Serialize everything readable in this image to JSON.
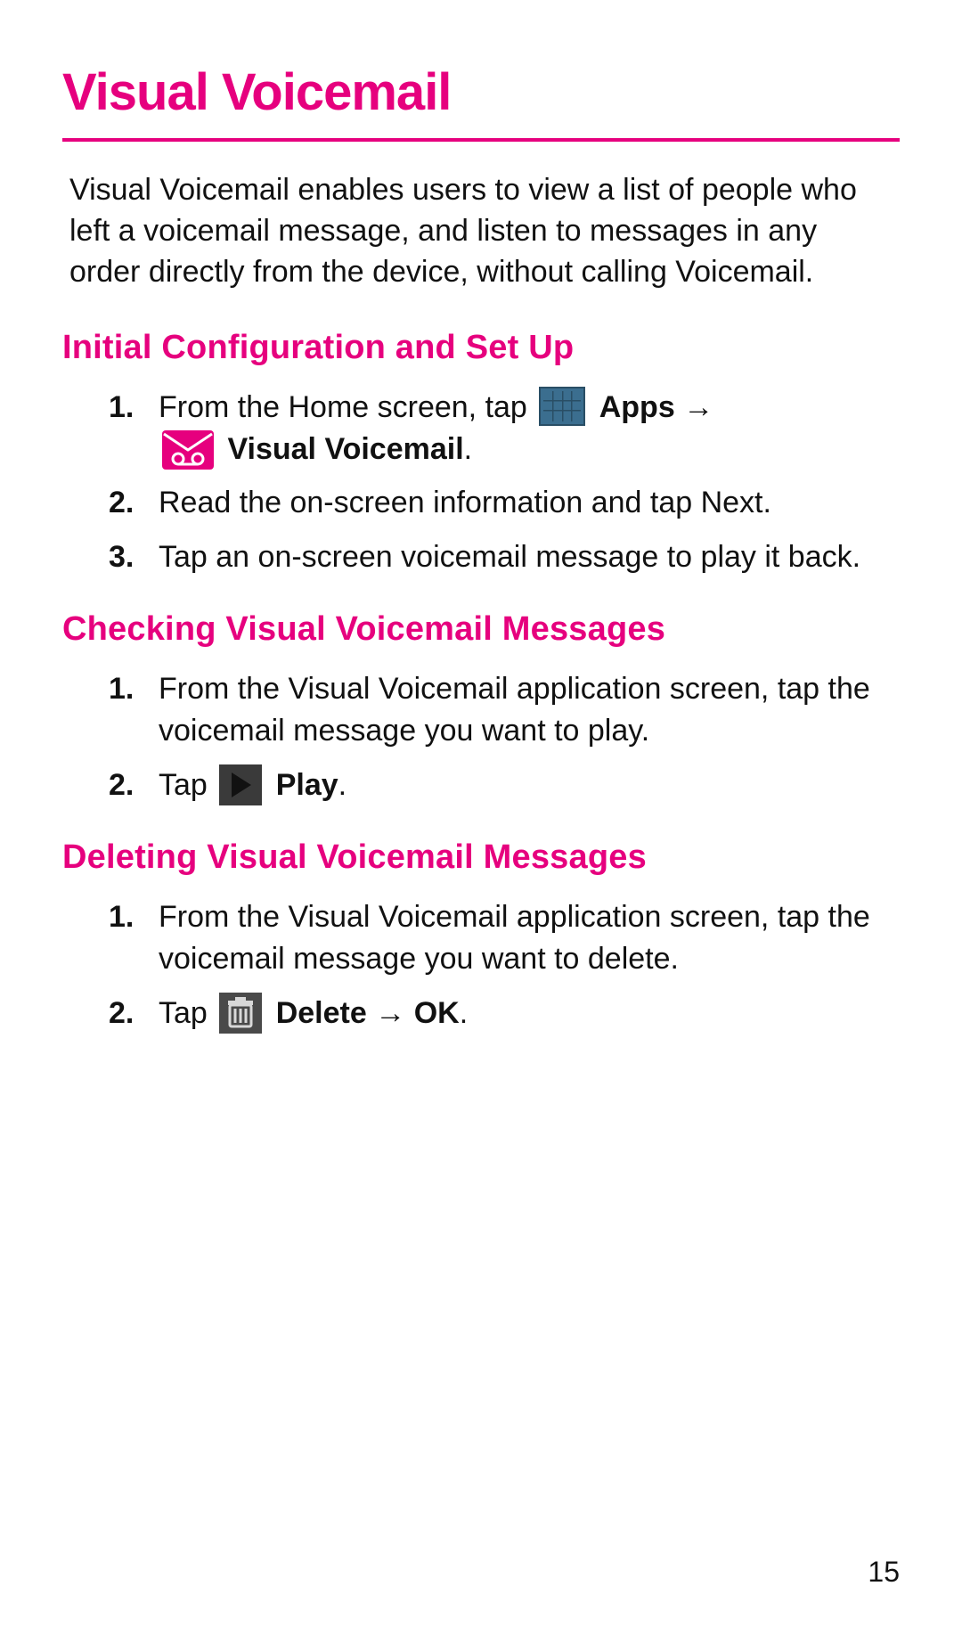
{
  "title": "Visual Voicemail",
  "intro": "Visual Voicemail enables users to view a list of people who left a voicemail message, and listen to messages in any order directly from the device, without calling Voicemail.",
  "section1": {
    "title": "Initial Configuration and Set Up",
    "step1_pre": "From the Home screen, tap ",
    "step1_apps": "Apps",
    "step1_arrow": "→",
    "step1_vvm": "Visual Voicemail",
    "step1_period": ".",
    "step2": "Read the on-screen information and tap Next.",
    "step3": "Tap an on-screen voicemail message to play it back."
  },
  "section2": {
    "title": "Checking Visual Voicemail Messages",
    "step1": "From the Visual Voicemail application screen, tap the voicemail message you want to play.",
    "step2_pre": "Tap ",
    "step2_play": "Play",
    "step2_period": "."
  },
  "section3": {
    "title": "Deleting Visual Voicemail Messages",
    "step1": "From the Visual Voicemail application screen, tap the voicemail message you want to delete.",
    "step2_pre": "Tap ",
    "step2_delete": "Delete",
    "step2_arrow": " → ",
    "step2_ok": "OK",
    "step2_period": "."
  },
  "pageNumber": "15",
  "colors": {
    "accent": "#e6007e"
  }
}
